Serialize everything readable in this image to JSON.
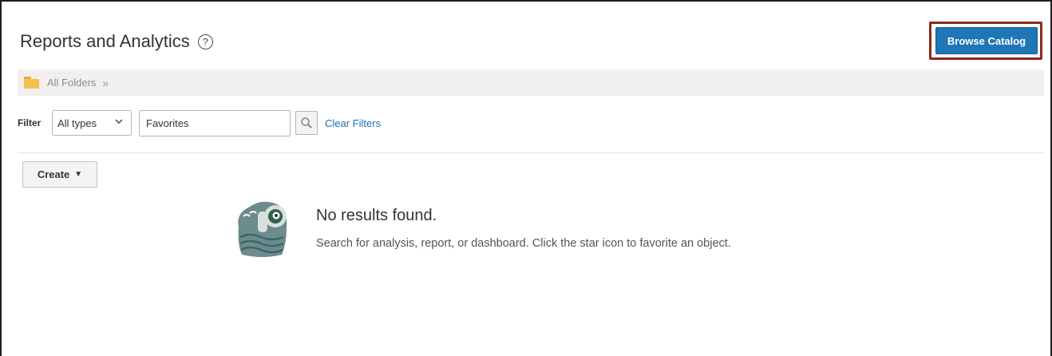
{
  "header": {
    "title": "Reports and Analytics",
    "help_icon": "question-circle-icon",
    "browse_label": "Browse Catalog",
    "accent": "#1f76b6",
    "highlight": "#8a2a1c"
  },
  "breadcrumb": {
    "folder_icon": "folder-icon",
    "label": "All Folders",
    "chevron": "»"
  },
  "filter": {
    "label": "Filter",
    "type_value": "All types",
    "search_value": "Favorites",
    "search_icon": "magnifier-icon",
    "clear_label": "Clear Filters"
  },
  "toolbar": {
    "create_label": "Create",
    "create_caret": "▼"
  },
  "empty_state": {
    "illustration": "binoculars-illustration",
    "title": "No results found.",
    "hint": "Search for analysis, report, or dashboard. Click the star icon to favorite an object."
  }
}
